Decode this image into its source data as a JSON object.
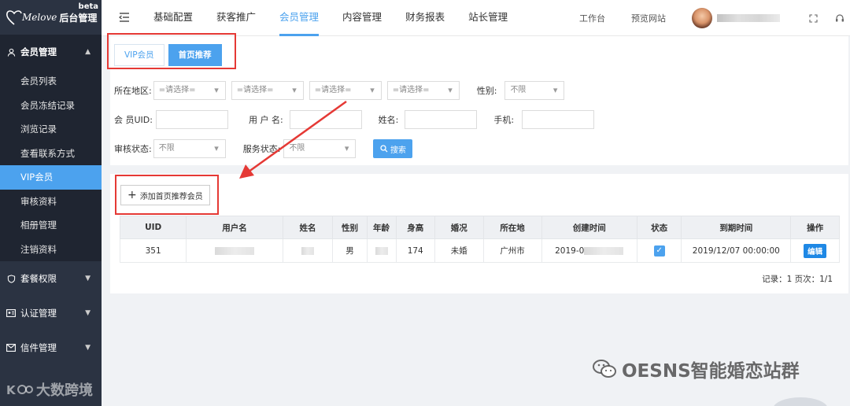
{
  "brand": {
    "script": "Melove",
    "title": "后台管理",
    "badge": "beta"
  },
  "sidebar": {
    "groups": [
      {
        "label": "会员管理",
        "icon": "user-icon",
        "expanded": true,
        "items": [
          "会员列表",
          "会员冻结记录",
          "浏览记录",
          "查看联系方式",
          "VIP会员",
          "审核资料",
          "相册管理",
          "注销资料"
        ],
        "active_item": "VIP会员"
      },
      {
        "label": "套餐权限",
        "icon": "shield-icon"
      },
      {
        "label": "认证管理",
        "icon": "id-card-icon"
      },
      {
        "label": "信件管理",
        "icon": "mail-icon"
      }
    ],
    "watermark": "大数跨境"
  },
  "topnav": {
    "items": [
      "基础配置",
      "获客推广",
      "会员管理",
      "内容管理",
      "财务报表",
      "站长管理"
    ],
    "active": "会员管理",
    "links": [
      "工作台",
      "预览网站"
    ]
  },
  "tabs": {
    "items": [
      "VIP会员",
      "首页推荐"
    ],
    "active": "首页推荐"
  },
  "filters": {
    "region_label": "所在地区:",
    "region_selects": [
      "=请选择=",
      "=请选择=",
      "=请选择=",
      "=请选择="
    ],
    "gender_label": "性别:",
    "gender_value": "不限",
    "uid_label": "会 员UID:",
    "username_label": "用 户 名:",
    "name_label": "姓名:",
    "phone_label": "手机:",
    "audit_label": "审核状态:",
    "audit_value": "不限",
    "service_label": "服务状态:",
    "service_value": "不限",
    "search_button": "搜索"
  },
  "add_button": "添加首页推荐会员",
  "table": {
    "headers": [
      "UID",
      "用户名",
      "姓名",
      "性别",
      "年龄",
      "身高",
      "婚况",
      "所在地",
      "创建时间",
      "状态",
      "到期时间",
      "操作"
    ],
    "rows": [
      {
        "uid": "351",
        "gender": "男",
        "height": "174",
        "marital": "未婚",
        "location": "广州市",
        "created": "2019-0",
        "status_checked": true,
        "expiry": "2019/12/07 00:00:00",
        "action": "编辑"
      }
    ]
  },
  "pager": {
    "text": "记录：1  页次：1/1"
  },
  "watermark": "OESNS智能婚恋站群",
  "colors": {
    "accent": "#4ca2ee",
    "sidebar": "#2b3342",
    "annotation": "#e53935",
    "expiry": "#2e9a2e"
  }
}
